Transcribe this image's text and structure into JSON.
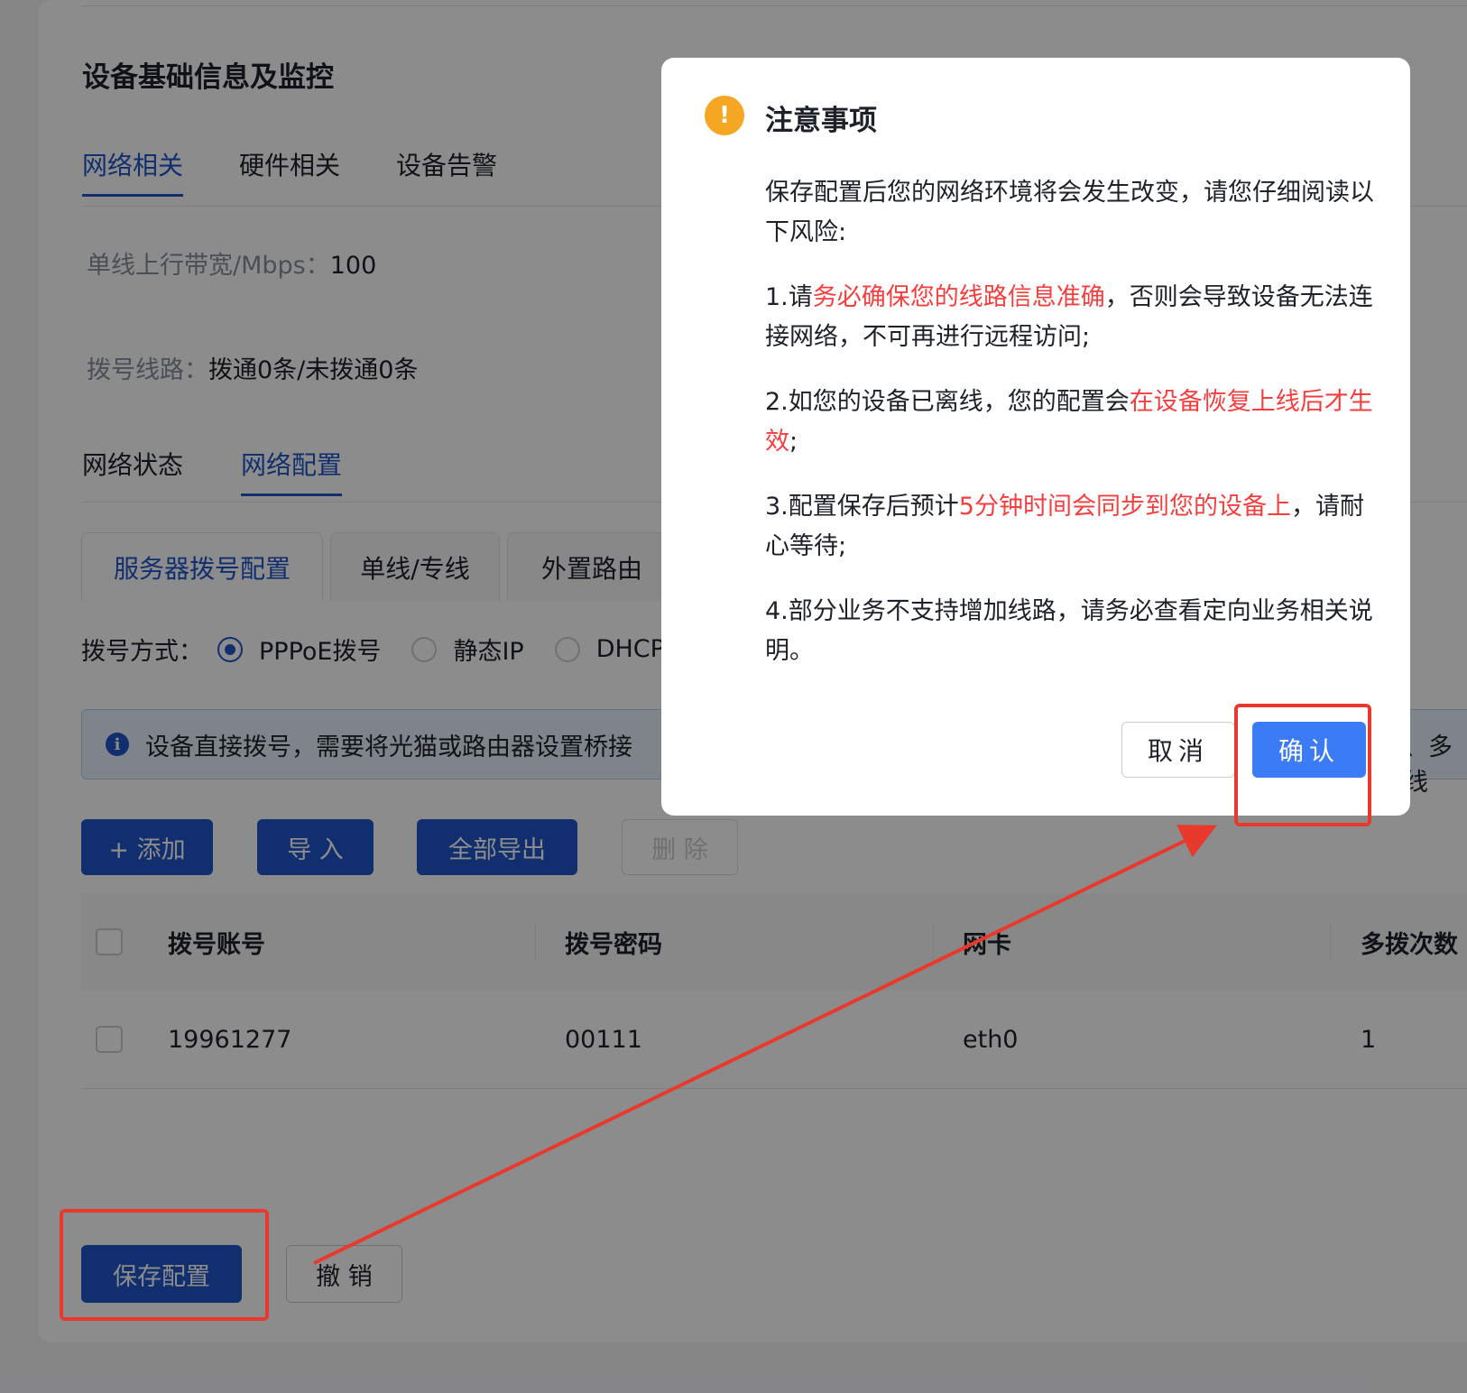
{
  "page": {
    "title": "设备基础信息及监控",
    "main_tabs": [
      {
        "label": "网络相关",
        "active": true
      },
      {
        "label": "硬件相关",
        "active": false
      },
      {
        "label": "设备告警",
        "active": false
      }
    ],
    "bandwidth": {
      "label": "单线上行带宽/Mbps：",
      "value": "100"
    },
    "dial_lines": {
      "label": "拨号线路：",
      "value": "拨通0条/未拨通0条"
    },
    "sub_tabs": [
      {
        "label": "网络状态",
        "active": false
      },
      {
        "label": "网络配置",
        "active": true
      }
    ],
    "config_tabs": [
      {
        "label": "服务器拨号配置",
        "active": true
      },
      {
        "label": "单线/专线",
        "active": false
      },
      {
        "label": "外置路由",
        "active": false
      }
    ],
    "dial_mode": {
      "label": "拨号方式：",
      "options": [
        {
          "label": "PPPoE拨号",
          "checked": true
        },
        {
          "label": "静态IP",
          "checked": false
        },
        {
          "label": "DHCP",
          "checked": false
        }
      ]
    },
    "alert": {
      "text": "设备直接拨号，需要将光猫或路由器设置桥接",
      "tail": "、多线"
    },
    "toolbar": {
      "add": "+ 添加",
      "import": "导 入",
      "export_all": "全部导出",
      "delete": "删 除"
    },
    "table": {
      "headers": [
        "拨号账号",
        "拨号密码",
        "网卡",
        "多拨次数"
      ],
      "rows": [
        {
          "account": "19961277",
          "password": "00111",
          "nic": "eth0",
          "multi_dial": "1"
        }
      ]
    },
    "footer": {
      "save": "保存配置",
      "revoke": "撤 销"
    }
  },
  "modal": {
    "title": "注意事项",
    "intro": "保存配置后您的网络环境将会发生改变，请您仔细阅读以下风险:",
    "items": [
      {
        "pre": "1.请",
        "red": "务必确保您的线路信息准确",
        "post": "，否则会导致设备无法连接网络，不可再进行远程访问;"
      },
      {
        "pre": "2.如您的设备已离线，您的配置会",
        "red": "在设备恢复上线后才生效",
        "post": ";"
      },
      {
        "pre": "3.配置保存后预计",
        "red": "5分钟时间会同步到您的设备上",
        "post": "，请耐心等待;"
      },
      {
        "pre": "4.部分业务不支持增加线路，请务必查看定向业务相关说明。",
        "red": "",
        "post": ""
      }
    ],
    "cancel": "取消",
    "confirm": "确认"
  },
  "colors": {
    "primary": "#1f54c9",
    "confirm": "#3b7cf6",
    "warning": "#f5a623",
    "danger_text": "#f53f3f",
    "annotation": "#e8392c"
  }
}
